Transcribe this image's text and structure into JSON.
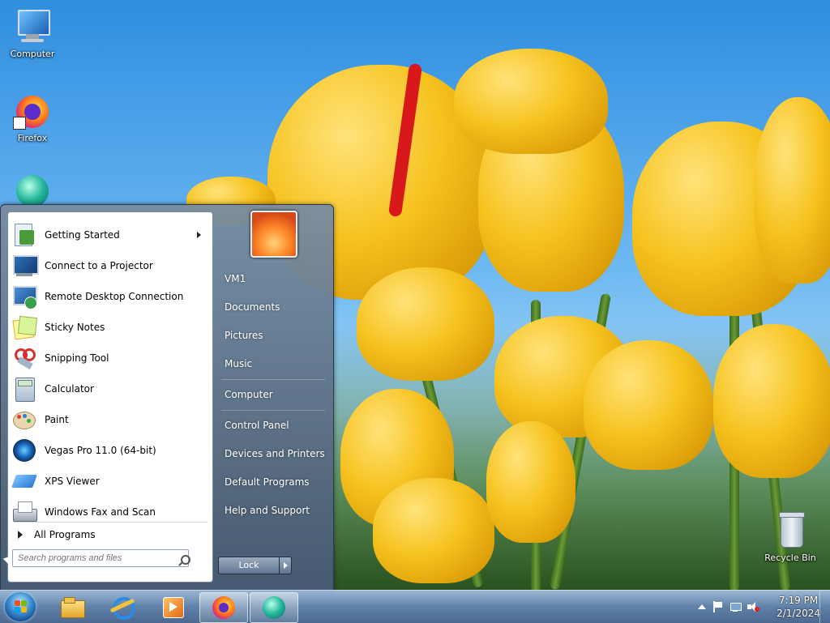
{
  "desktop": {
    "icons": [
      {
        "label": "Computer"
      },
      {
        "label": "Firefox"
      },
      {
        "label": "Recycle Bin"
      }
    ]
  },
  "start_menu": {
    "programs": [
      {
        "label": "Getting Started",
        "icon": "getting-started-icon",
        "has_submenu": true
      },
      {
        "label": "Connect to a Projector",
        "icon": "projector-icon"
      },
      {
        "label": "Remote Desktop Connection",
        "icon": "remote-desktop-icon"
      },
      {
        "label": "Sticky Notes",
        "icon": "sticky-notes-icon"
      },
      {
        "label": "Snipping Tool",
        "icon": "snipping-tool-icon"
      },
      {
        "label": "Calculator",
        "icon": "calculator-icon"
      },
      {
        "label": "Paint",
        "icon": "paint-icon"
      },
      {
        "label": "Vegas Pro 11.0 (64-bit)",
        "icon": "vegas-pro-icon"
      },
      {
        "label": "XPS Viewer",
        "icon": "xps-viewer-icon"
      },
      {
        "label": "Windows Fax and Scan",
        "icon": "fax-scan-icon"
      }
    ],
    "all_programs": "All Programs",
    "search_placeholder": "Search programs and files",
    "right_links": [
      {
        "label": "VM1"
      },
      {
        "label": "Documents"
      },
      {
        "label": "Pictures"
      },
      {
        "label": "Music"
      },
      {
        "label": "Computer"
      },
      {
        "label": "Control Panel"
      },
      {
        "label": "Devices and Printers"
      },
      {
        "label": "Default Programs"
      },
      {
        "label": "Help and Support"
      }
    ],
    "lock_label": "Lock"
  },
  "taskbar": {
    "pinned": [
      "explorer-icon",
      "internet-explorer-icon",
      "media-player-icon",
      "firefox-icon",
      "app-icon"
    ],
    "clock": {
      "time": "7:19 PM",
      "date": "2/1/2024"
    }
  },
  "colors": {
    "accent": "#3a8ed4",
    "menu_text_dark": "#000000",
    "menu_text_light": "#ffffff"
  }
}
